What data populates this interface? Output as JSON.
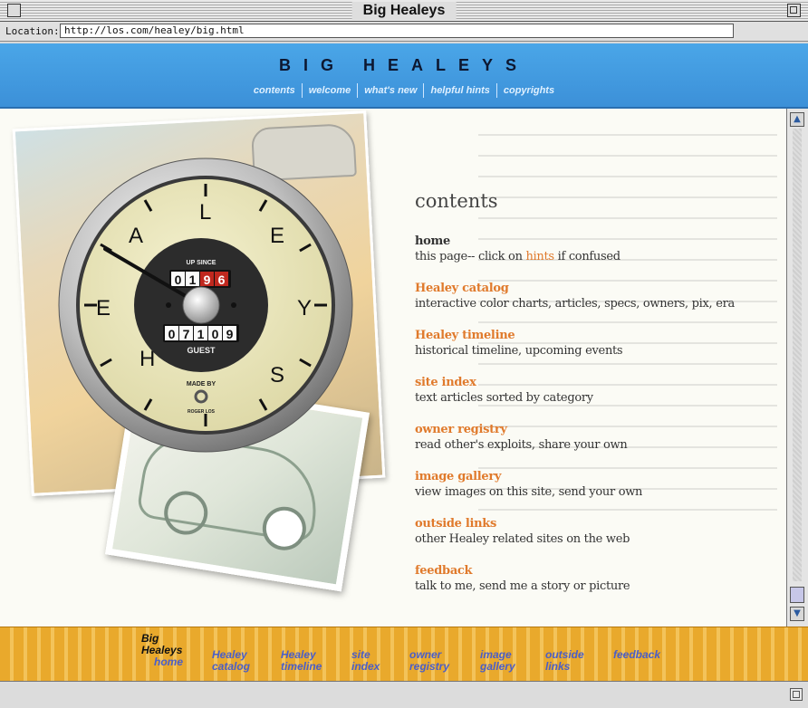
{
  "window": {
    "title": "Big Healeys"
  },
  "location": {
    "label": "Location:",
    "url": "http://los.com/healey/big.html"
  },
  "header": {
    "site_title": "BIG HEALEYS",
    "nav": [
      "contents",
      "welcome",
      "what's new",
      "helpful hints",
      "copyrights"
    ]
  },
  "gauge": {
    "letters": [
      "H",
      "E",
      "A",
      "L",
      "E",
      "Y",
      "S"
    ],
    "up_since_label": "UP SINCE",
    "up_since_digits": [
      "0",
      "1",
      "9",
      "6"
    ],
    "guest_digits": [
      "0",
      "7",
      "1",
      "0",
      "9"
    ],
    "guest_label": "GUEST",
    "made_by_label": "MADE BY",
    "maker": "ROGER LOS"
  },
  "contents": {
    "heading": "contents",
    "items": [
      {
        "title": "home",
        "desc_pre": "this page-- click on ",
        "desc_link": "hints",
        "desc_post": " if confused"
      },
      {
        "title": "Healey catalog",
        "desc": "interactive color charts, articles, specs, owners, pix, era"
      },
      {
        "title": "Healey timeline",
        "desc": "historical timeline, upcoming events"
      },
      {
        "title": "site index",
        "desc": "text articles sorted by category"
      },
      {
        "title": "owner registry",
        "desc": "read other's exploits, share your own"
      },
      {
        "title": "image gallery",
        "desc": "view images on this site, send your own"
      },
      {
        "title": "outside links",
        "desc": "other Healey related sites on the web"
      },
      {
        "title": "feedback",
        "desc": "talk to me, send me a story or picture"
      }
    ]
  },
  "bottom_nav": {
    "home": {
      "line1": "Big",
      "line2": "Healeys",
      "line3": "home"
    },
    "links": [
      {
        "line1": "Healey",
        "line2": "catalog"
      },
      {
        "line1": "Healey",
        "line2": "timeline"
      },
      {
        "line1": "site",
        "line2": "index"
      },
      {
        "line1": "owner",
        "line2": "registry"
      },
      {
        "line1": "image",
        "line2": "gallery"
      },
      {
        "line1": "outside",
        "line2": "links"
      },
      {
        "line1": "feedback",
        "line2": ""
      }
    ]
  },
  "colors": {
    "header_blue": "#3c90d8",
    "link_orange": "#e07a2c",
    "footer_gold": "#e9a92c",
    "bottom_link_blue": "#4a5ec8"
  }
}
